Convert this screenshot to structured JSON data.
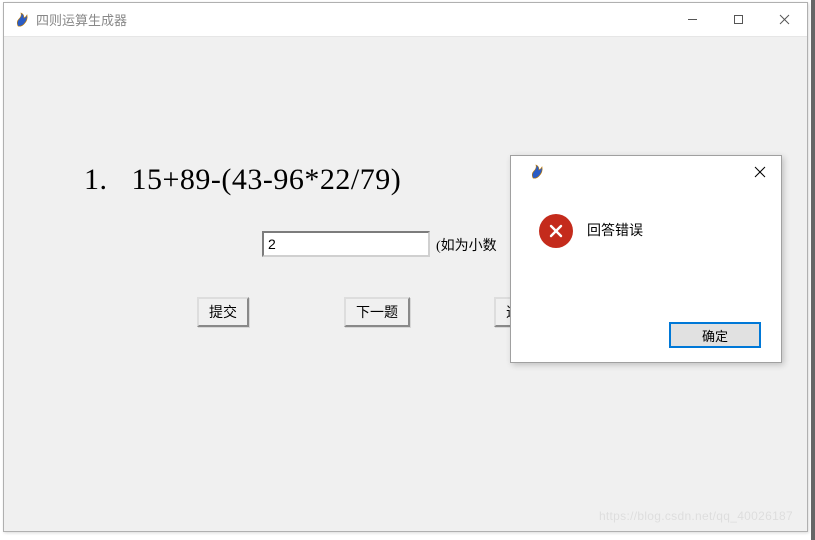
{
  "window": {
    "title": "四则运算生成器"
  },
  "question": {
    "number": "1.",
    "expression": "15+89-(43-96*22/79)"
  },
  "answer": {
    "value": "2",
    "hint": "(如为小数"
  },
  "buttons": {
    "submit": "提交",
    "next": "下一题",
    "exit": "退出并显示"
  },
  "dialog": {
    "message": "回答错误",
    "ok": "确定"
  },
  "watermark": "https://blog.csdn.net/qq_40026187"
}
